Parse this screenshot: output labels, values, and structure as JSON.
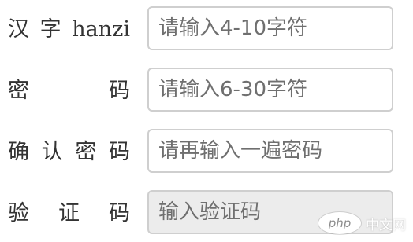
{
  "form": {
    "rows": [
      {
        "label_parts": [
          "汉",
          "字",
          "hanzi"
        ],
        "placeholder": "请输入4-10字符"
      },
      {
        "label_parts": [
          "密",
          "码"
        ],
        "placeholder": "请输入6-30字符"
      },
      {
        "label_parts": [
          "确",
          "认",
          "密",
          "码"
        ],
        "placeholder": "请再输入一遍密码"
      },
      {
        "label_parts": [
          "验",
          "证",
          "码"
        ],
        "placeholder": "输入验证码"
      }
    ]
  },
  "watermark": {
    "logo_text": "php",
    "brand_text": "中文网"
  }
}
